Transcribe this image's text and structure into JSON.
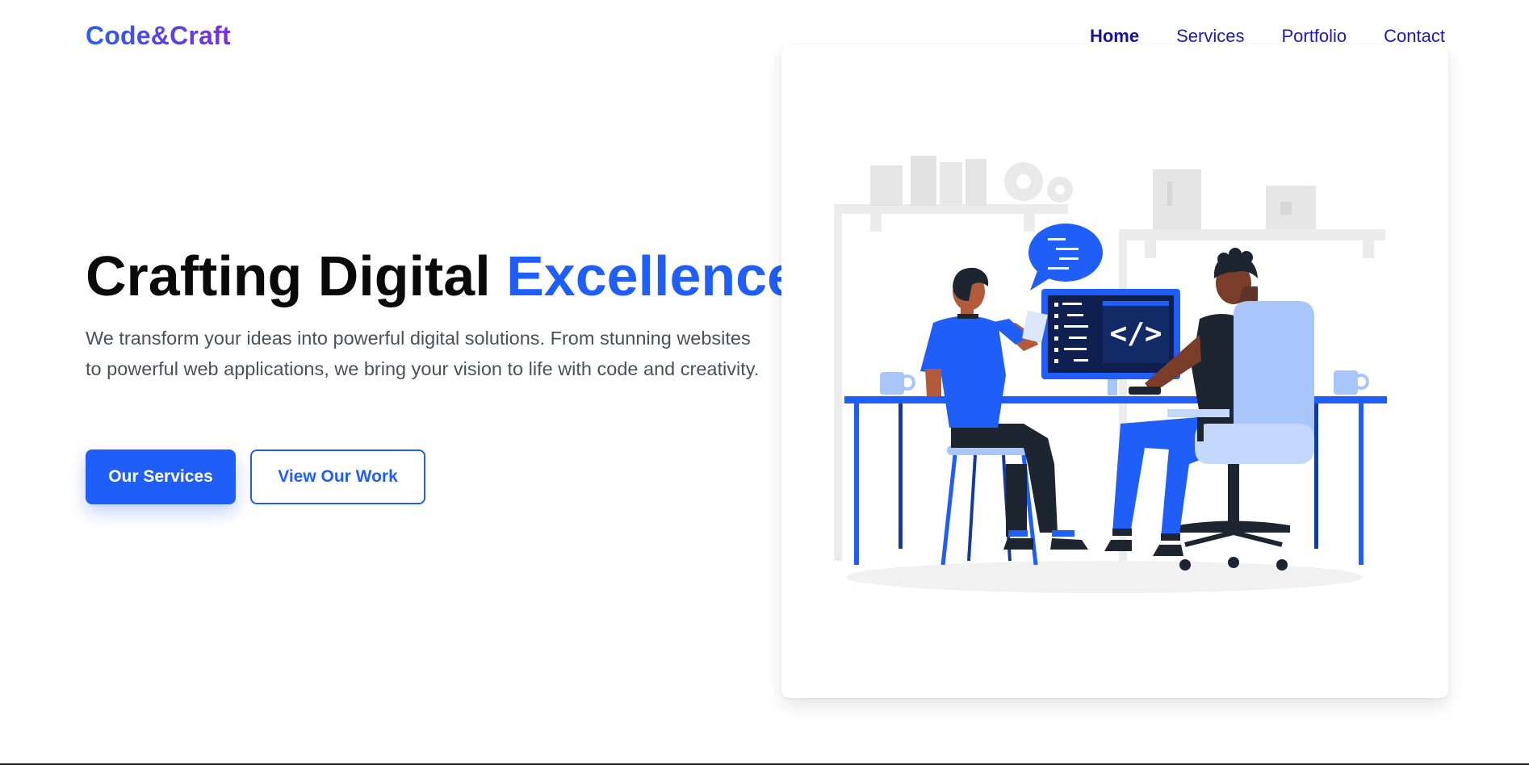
{
  "header": {
    "logo": "Code&Craft",
    "nav": [
      {
        "label": "Home",
        "active": true
      },
      {
        "label": "Services",
        "active": false
      },
      {
        "label": "Portfolio",
        "active": false
      },
      {
        "label": "Contact",
        "active": false
      }
    ]
  },
  "hero": {
    "title_main": "Crafting Digital ",
    "title_accent": "Excellence",
    "description": "We transform your ideas into powerful digital solutions. From stunning websites to powerful web applications, we bring your vision to life with code and creativity.",
    "primary_button": "Our Services",
    "secondary_button": "View Our Work",
    "illustration": {
      "subject": "two developers working at a desk",
      "code_symbol": "</>"
    }
  },
  "colors": {
    "accent": "#1f5ef7",
    "nav_link": "#1d1ab8",
    "text_dark": "#0a0a0a",
    "text_body": "#4b5059",
    "logo_gradient_start": "#2f5fe8",
    "logo_gradient_end": "#7a2de0"
  }
}
